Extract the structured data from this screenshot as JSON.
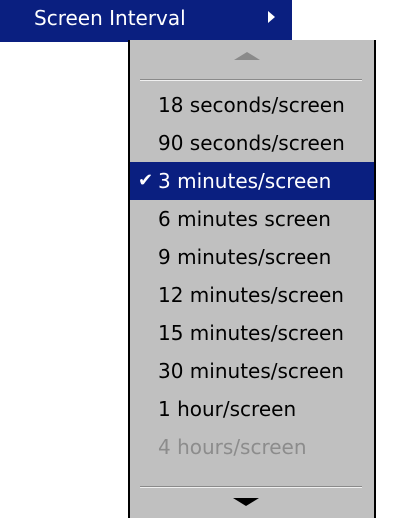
{
  "parent_menu": {
    "label": "Screen Interval",
    "submenu_arrow_icon": "triangle-right-icon"
  },
  "submenu": {
    "scroll_up_icon": "triangle-up-icon",
    "scroll_down_icon": "triangle-down-icon",
    "items": [
      {
        "label": "18 seconds/screen",
        "state": "normal"
      },
      {
        "label": "90 seconds/screen",
        "state": "normal"
      },
      {
        "label": "3 minutes/screen",
        "state": "selected",
        "check_icon": "checkmark-icon",
        "check_glyph": "✔"
      },
      {
        "label": "6 minutes screen",
        "state": "normal"
      },
      {
        "label": "9 minutes/screen",
        "state": "normal"
      },
      {
        "label": "12 minutes/screen",
        "state": "normal"
      },
      {
        "label": "15 minutes/screen",
        "state": "normal"
      },
      {
        "label": "30 minutes/screen",
        "state": "normal"
      },
      {
        "label": "1 hour/screen",
        "state": "normal"
      },
      {
        "label": "4 hours/screen",
        "state": "disabled"
      }
    ]
  },
  "colors": {
    "highlight_bg": "#0a1f80",
    "highlight_fg": "#ffffff",
    "menu_bg": "#c0c0c0",
    "disabled_fg": "#8c8c8c",
    "scroll_up_arrow": "#8a8a8a",
    "scroll_down_arrow": "#000000"
  }
}
